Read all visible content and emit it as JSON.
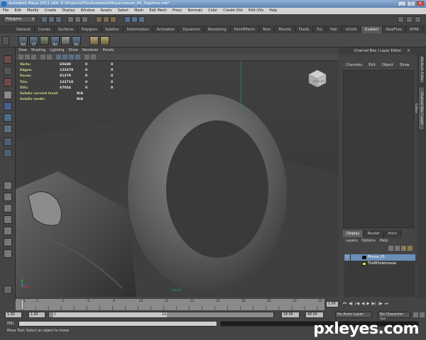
{
  "window": {
    "title": "Autodesk Maya 2011 x64: E:\\Projects\\File\\Autodesk\\Maya\\mouse_All_Together.mb*",
    "minimize": "_",
    "maximize": "□",
    "close": "×"
  },
  "menubar": [
    "File",
    "Edit",
    "Modify",
    "Create",
    "Display",
    "Window",
    "Assets",
    "Select",
    "Mesh",
    "Edit Mesh",
    "Proxy",
    "Normals",
    "Color",
    "Create UVs",
    "Edit UVs",
    "Help"
  ],
  "status_line": {
    "mode": "Polygons"
  },
  "shelf": {
    "tabs": [
      "General",
      "Curves",
      "Surfaces",
      "Polygons",
      "Subdivs",
      "Deformation",
      "Animation",
      "Dynamics",
      "Rendering",
      "PaintEffects",
      "Toon",
      "Muscle",
      "Fluids",
      "Fur",
      "Hair",
      "nCloth",
      "Custom",
      "RealFlow",
      "RFRK"
    ],
    "active_tab": "Custom",
    "buttons": [
      "Out",
      "CP",
      "",
      "Hio",
      "",
      "Hio",
      "",
      ""
    ]
  },
  "viewport": {
    "menu": [
      "View",
      "Shading",
      "Lighting",
      "Show",
      "Renderer",
      "Panels"
    ],
    "hud": [
      {
        "label": "Verts:",
        "v1": "65688",
        "v2": "0",
        "v3": "0"
      },
      {
        "label": "Edges:",
        "v1": "123279",
        "v2": "0",
        "v3": "0"
      },
      {
        "label": "Faces:",
        "v1": "61379",
        "v2": "0",
        "v3": "0"
      },
      {
        "label": "Tris:",
        "v1": "122718",
        "v2": "0",
        "v3": "0"
      },
      {
        "label": "UVs:",
        "v1": "67054",
        "v2": "0",
        "v3": "0"
      },
      {
        "label": "Subdiv current level:",
        "v1": "N/A",
        "v2": "",
        "v3": ""
      },
      {
        "label": "Subdiv mode:",
        "v1": "N/A",
        "v2": "",
        "v3": ""
      }
    ],
    "viewcube": {
      "left_face": "BACK",
      "right_face": "LEFT"
    },
    "camera_label": "persp"
  },
  "channel_box": {
    "header": "Channel Box / Layer Editor",
    "menu": [
      "Channels",
      "Edit",
      "Object",
      "Show"
    ]
  },
  "layer_editor": {
    "tabs": [
      "Display",
      "Render",
      "Anim"
    ],
    "active_tab": "Display",
    "menu": [
      "Layers",
      "Options",
      "Help"
    ],
    "layers": [
      {
        "visible": "V",
        "name": "Mouse_01",
        "color": "#000000",
        "selected": true
      },
      {
        "visible": "",
        "name": "TheWholemouse",
        "color": "#f2e500",
        "selected": false
      }
    ]
  },
  "side_tabs": [
    "Attribute Editor",
    "Channel Box / Layer Editor"
  ],
  "time_slider": {
    "ticks": [
      "1",
      "2",
      "4",
      "6",
      "8",
      "10",
      "12",
      "14",
      "16",
      "18",
      "20",
      "22",
      "24"
    ],
    "current_frame": "1.00"
  },
  "range_slider": {
    "start": "1.00",
    "inner_start": "1.00",
    "inner_start_box": "1",
    "inner_end_box": "24",
    "inner_end": "24.00",
    "end": "48.00",
    "anim_layer": "No Anim Layer",
    "character_set": "No Character Set"
  },
  "command_line": {
    "label": "MEL"
  },
  "help_line": "Move Tool: Select an object to move.",
  "watermark": "pxleyes.com",
  "colors": {
    "viewport_bg": "#3b3b3b",
    "selected_layer": "#6a8fb7",
    "hud_label": "#c9d98a",
    "active_tab": "#5f5f5f"
  }
}
